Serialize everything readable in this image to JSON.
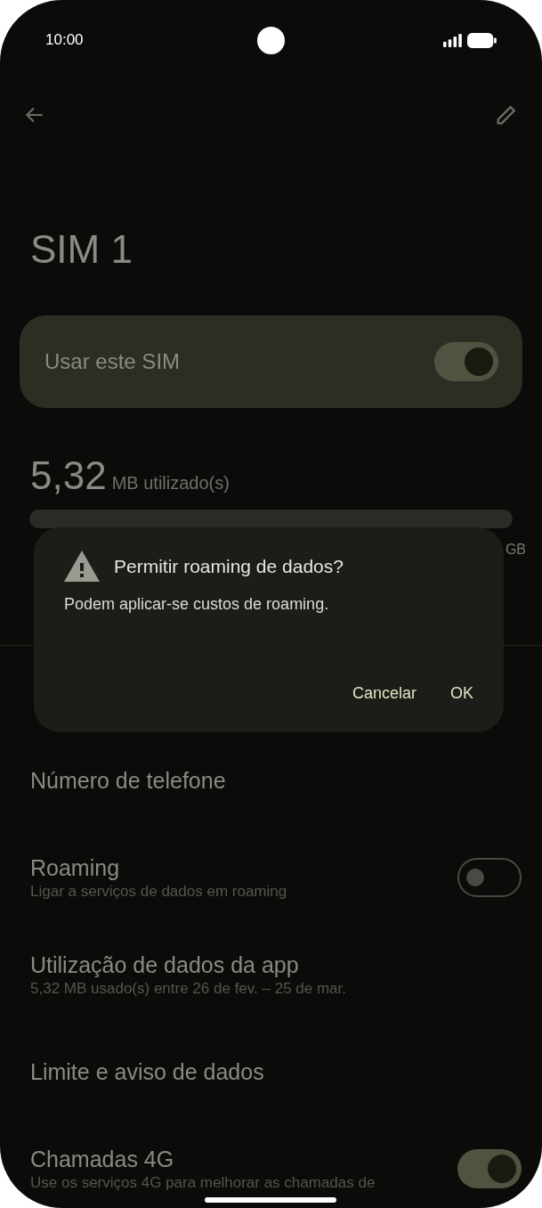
{
  "status_bar": {
    "time": "10:00"
  },
  "title": "SIM 1",
  "use_sim": {
    "label": "Usar este SIM",
    "on": true
  },
  "usage": {
    "amount": "5,32",
    "unit": "MB utilizado(s)",
    "right_label": "GB"
  },
  "settings": [
    {
      "title": "Número de telefone"
    },
    {
      "title": "Roaming",
      "subtitle": "Ligar a serviços de dados em roaming",
      "kind": "switch",
      "on": false
    },
    {
      "title": "Utilização de dados da app",
      "subtitle": "5,32 MB usado(s) entre 26 de fev. – 25 de mar."
    },
    {
      "title": "Limite e aviso de dados"
    },
    {
      "title": "Chamadas 4G",
      "subtitle": "Use os serviços 4G para melhorar as chamadas de",
      "kind": "switch",
      "on": true
    }
  ],
  "dialog": {
    "title": "Permitir roaming de dados?",
    "message": "Podem aplicar-se custos de roaming.",
    "buttons": [
      "Cancelar",
      "OK"
    ]
  }
}
